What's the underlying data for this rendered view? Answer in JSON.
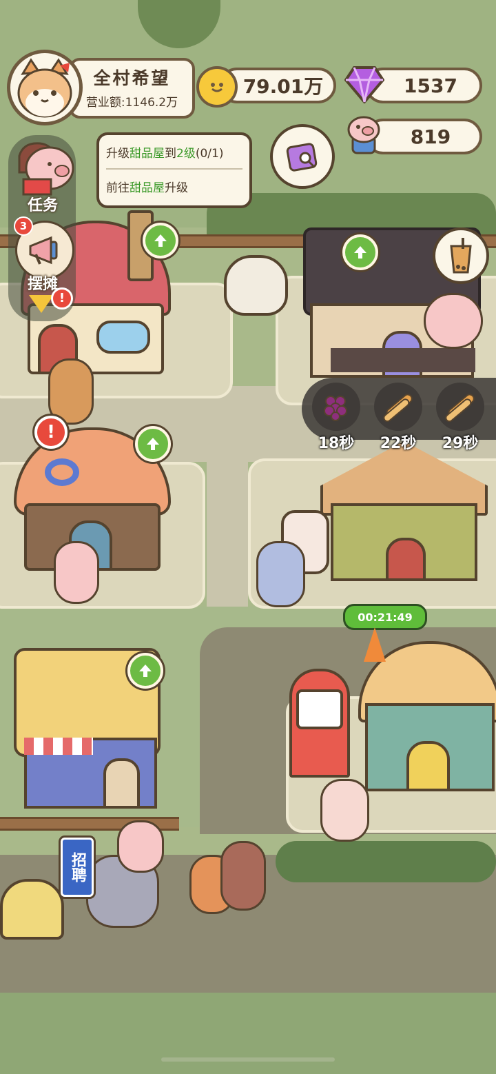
{
  "profile": {
    "name": "全村希望",
    "revenue": "营业额:1146.2万"
  },
  "currency": {
    "coins": "79.01万",
    "gems": "1537",
    "pigs": "819"
  },
  "quest": {
    "line1_prefix": "升级",
    "line1_target": "甜品屋",
    "line1_mid": "到",
    "line1_level": "2级",
    "line1_progress": "(0/1)",
    "line2_prefix": "前往",
    "line2_target": "甜品屋",
    "line2_suffix": "升级",
    "label": "任务"
  },
  "stall": {
    "label": "摆摊",
    "badge": "3"
  },
  "production": [
    {
      "icon": "grape-icon",
      "time": "18秒"
    },
    {
      "icon": "bread-icon",
      "time": "22秒"
    },
    {
      "icon": "bread-icon",
      "time": "29秒"
    }
  ],
  "build_timer": "00:21:49",
  "recruit_sign": "招聘",
  "colors": {
    "accent_green": "#6dbb44",
    "alert_red": "#e8493c",
    "quest_highlight": "#3c9a2a",
    "outline": "#55432e"
  }
}
